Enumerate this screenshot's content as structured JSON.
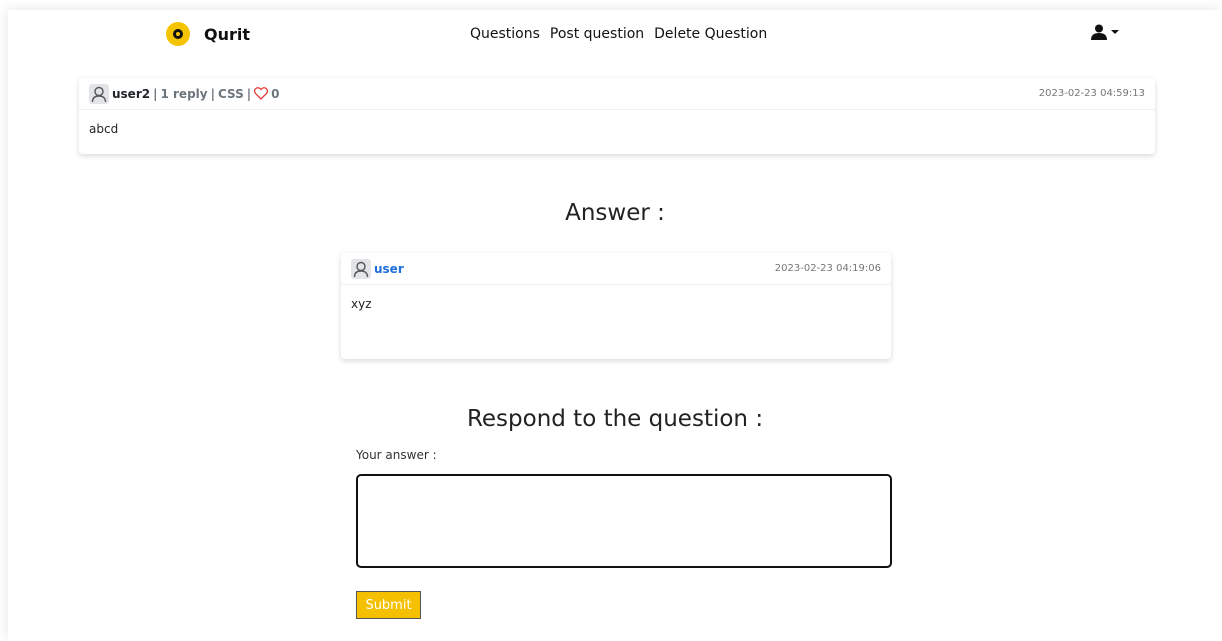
{
  "brand": {
    "name": "Qurit",
    "accent": "#f5c400"
  },
  "nav": {
    "links": [
      "Questions",
      "Post question",
      "Delete Question"
    ]
  },
  "user_menu": {
    "icon": "user-icon",
    "caret": "caret-down-icon"
  },
  "question": {
    "author": "user2",
    "replies": "1 reply",
    "tag": "CSS",
    "likes": "0",
    "separator": "|",
    "timestamp": "2023-02-23 04:59:13",
    "body": "abcd"
  },
  "answers_section": {
    "title": "Answer :",
    "items": [
      {
        "author": "user",
        "timestamp": "2023-02-23 04:19:06",
        "body": "xyz"
      }
    ]
  },
  "respond": {
    "title": "Respond to the question :",
    "label": "Your answer :",
    "input_value": "",
    "submit_label": "Submit",
    "submit_color": "#f5c000"
  }
}
